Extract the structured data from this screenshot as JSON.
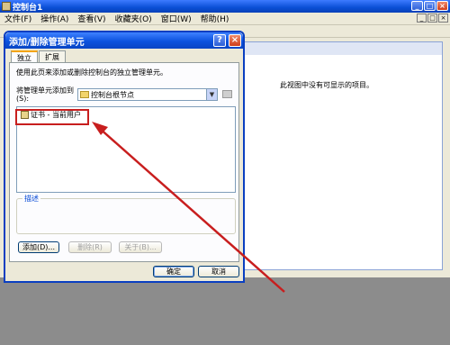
{
  "main_window": {
    "title": "控制台1",
    "buttons": {
      "minimize": "_",
      "maximize": "□",
      "close": "×"
    }
  },
  "menubar": {
    "items": [
      "文件(F)",
      "操作(A)",
      "查看(V)",
      "收藏夹(O)",
      "窗口(W)",
      "帮助(H)"
    ]
  },
  "right_pane": {
    "empty_message": "此视图中没有可显示的项目。"
  },
  "dialog": {
    "title": "添加/删除管理单元",
    "help_label": "?",
    "close_label": "×",
    "tabs": [
      "独立",
      "扩展"
    ],
    "description": "使用此页来添加或删除控制台的独立管理单元。",
    "snapin_label": "将管理单元添加到(S):",
    "snapin_value": "控制台根节点",
    "list_items": [
      "证书 - 当前用户"
    ],
    "desc_group_label": "描述",
    "buttons": {
      "add": "添加(D)...",
      "remove": "删除(R)",
      "about": "关于(B)...",
      "ok": "确定",
      "cancel": "取消"
    }
  },
  "annotation": {
    "color": "#c81e1e"
  }
}
